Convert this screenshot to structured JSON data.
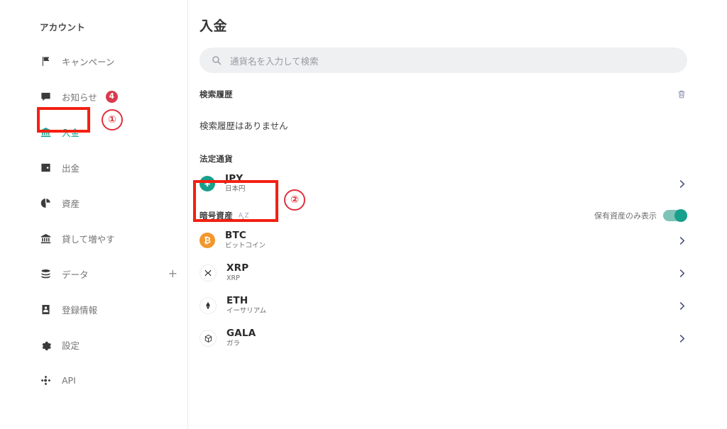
{
  "sidebar": {
    "heading": "アカウント",
    "items": [
      {
        "label": "キャンペーン",
        "icon": "flag-icon",
        "badge": null,
        "active": false,
        "plus": false
      },
      {
        "label": "お知らせ",
        "icon": "message-icon",
        "badge": "4",
        "active": false,
        "plus": false
      },
      {
        "label": "入金",
        "icon": "bank-icon",
        "badge": null,
        "active": true,
        "plus": false
      },
      {
        "label": "出金",
        "icon": "wallet-icon",
        "badge": null,
        "active": false,
        "plus": false
      },
      {
        "label": "資産",
        "icon": "pie-chart-icon",
        "badge": null,
        "active": false,
        "plus": false
      },
      {
        "label": "貸して増やす",
        "icon": "bank-icon",
        "badge": null,
        "active": false,
        "plus": false
      },
      {
        "label": "データ",
        "icon": "database-icon",
        "badge": null,
        "active": false,
        "plus": true,
        "plus_label": "+"
      },
      {
        "label": "登録情報",
        "icon": "id-card-icon",
        "badge": null,
        "active": false,
        "plus": false
      },
      {
        "label": "設定",
        "icon": "gear-icon",
        "badge": null,
        "active": false,
        "plus": false
      },
      {
        "label": "API",
        "icon": "api-node-icon",
        "badge": null,
        "active": false,
        "plus": false
      }
    ]
  },
  "main": {
    "title": "入金",
    "search": {
      "placeholder": "通貨名を入力して検索",
      "value": "",
      "icon": "search-icon"
    },
    "history": {
      "title": "検索履歴",
      "clear_icon": "trash-icon",
      "empty_text": "検索履歴はありません"
    },
    "fiat": {
      "title": "法定通貨",
      "rows": [
        {
          "symbol": "JPY",
          "name": "日本円",
          "icon": "yen-icon",
          "icon_style": "jpy",
          "chevron": "chevron-right-icon"
        }
      ]
    },
    "crypto": {
      "title": "暗号資産",
      "sort_icon": "sort-az-icon",
      "toggle": {
        "label": "保有資産のみ表示",
        "on": true
      },
      "rows": [
        {
          "symbol": "BTC",
          "name": "ビットコイン",
          "icon": "bitcoin-icon",
          "icon_style": "btc",
          "chevron": "chevron-right-icon"
        },
        {
          "symbol": "XRP",
          "name": "XRP",
          "icon": "xrp-icon",
          "icon_style": "plain",
          "chevron": "chevron-right-icon"
        },
        {
          "symbol": "ETH",
          "name": "イーサリアム",
          "icon": "ethereum-icon",
          "icon_style": "plain",
          "chevron": "chevron-right-icon"
        },
        {
          "symbol": "GALA",
          "name": "ガラ",
          "icon": "gala-cube-icon",
          "icon_style": "plain",
          "chevron": "chevron-right-icon"
        }
      ]
    }
  },
  "annotations": {
    "marker_one": "①",
    "marker_two": "②",
    "highlight_color": "#f32013",
    "marker_color": "#e0303c"
  },
  "theme": {
    "accent": "#17a08c",
    "badge": "#d93a4d",
    "btc": "#f2972e",
    "chevron": "#4c5782",
    "search_bg": "#eef0f2"
  }
}
